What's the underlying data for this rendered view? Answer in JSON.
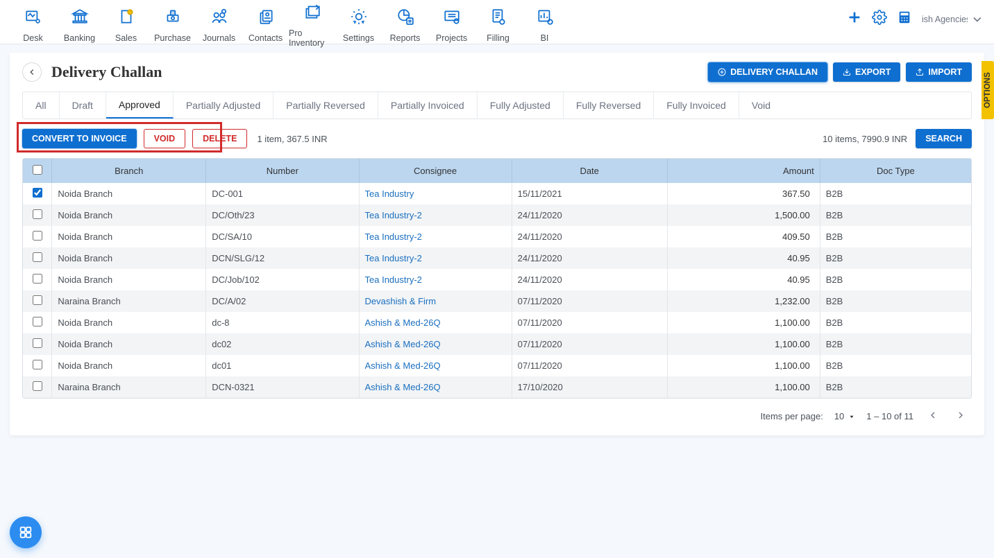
{
  "topnav": [
    "Desk",
    "Banking",
    "Sales",
    "Purchase",
    "Journals",
    "Contacts",
    "Pro Inventory",
    "Settings",
    "Reports",
    "Projects",
    "Filling",
    "BI"
  ],
  "org": {
    "name": "ish Agencies("
  },
  "page": {
    "title": "Delivery Challan",
    "primaryActions": {
      "challan": "DELIVERY CHALLAN",
      "export": "EXPORT",
      "import": "IMPORT"
    }
  },
  "tabs": [
    "All",
    "Draft",
    "Approved",
    "Partially Adjusted",
    "Partially Reversed",
    "Partially Invoiced",
    "Fully Adjusted",
    "Fully Reversed",
    "Fully Invoiced",
    "Void"
  ],
  "tabActiveIndex": 2,
  "bulkActions": {
    "convert": "CONVERT TO INVOICE",
    "void": "VOID",
    "delete": "DELETE",
    "selection": "1 item, 367.5 INR"
  },
  "summary": "10 items, 7990.9 INR",
  "searchLabel": "SEARCH",
  "optionsLabel": "OPTIONS",
  "table": {
    "headers": [
      "Branch",
      "Number",
      "Consignee",
      "Date",
      "Amount",
      "Doc Type"
    ],
    "rows": [
      {
        "checked": true,
        "branch": "Noida Branch",
        "number": "DC-001",
        "consignee": "Tea Industry",
        "date": "15/11/2021",
        "amount": "367.50",
        "doctype": "B2B"
      },
      {
        "checked": false,
        "branch": "Noida Branch",
        "number": "DC/Oth/23",
        "consignee": "Tea Industry-2",
        "date": "24/11/2020",
        "amount": "1,500.00",
        "doctype": "B2B"
      },
      {
        "checked": false,
        "branch": "Noida Branch",
        "number": "DC/SA/10",
        "consignee": "Tea Industry-2",
        "date": "24/11/2020",
        "amount": "409.50",
        "doctype": "B2B"
      },
      {
        "checked": false,
        "branch": "Noida Branch",
        "number": "DCN/SLG/12",
        "consignee": "Tea Industry-2",
        "date": "24/11/2020",
        "amount": "40.95",
        "doctype": "B2B"
      },
      {
        "checked": false,
        "branch": "Noida Branch",
        "number": "DC/Job/102",
        "consignee": "Tea Industry-2",
        "date": "24/11/2020",
        "amount": "40.95",
        "doctype": "B2B"
      },
      {
        "checked": false,
        "branch": "Naraina Branch",
        "number": "DC/A/02",
        "consignee": "Devashish & Firm",
        "date": "07/11/2020",
        "amount": "1,232.00",
        "doctype": "B2B"
      },
      {
        "checked": false,
        "branch": "Noida Branch",
        "number": "dc-8",
        "consignee": "Ashish & Med-26Q",
        "date": "07/11/2020",
        "amount": "1,100.00",
        "doctype": "B2B"
      },
      {
        "checked": false,
        "branch": "Noida Branch",
        "number": "dc02",
        "consignee": "Ashish & Med-26Q",
        "date": "07/11/2020",
        "amount": "1,100.00",
        "doctype": "B2B"
      },
      {
        "checked": false,
        "branch": "Noida Branch",
        "number": "dc01",
        "consignee": "Ashish & Med-26Q",
        "date": "07/11/2020",
        "amount": "1,100.00",
        "doctype": "B2B"
      },
      {
        "checked": false,
        "branch": "Naraina Branch",
        "number": "DCN-0321",
        "consignee": "Ashish & Med-26Q",
        "date": "17/10/2020",
        "amount": "1,100.00",
        "doctype": "B2B"
      }
    ]
  },
  "pager": {
    "label": "Items per page:",
    "size": "10",
    "range": "1 – 10 of 11"
  }
}
